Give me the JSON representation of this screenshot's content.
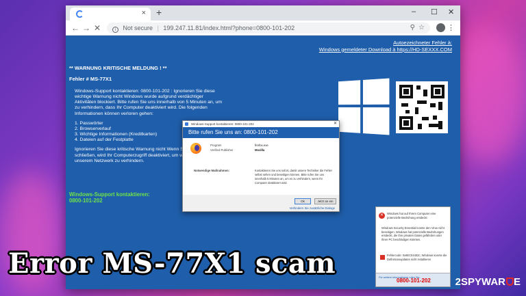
{
  "browser": {
    "tab_close": "×",
    "new_tab": "+",
    "window_controls": [
      "–",
      "☐",
      "✕"
    ],
    "nav": [
      "←",
      "→",
      "✕"
    ],
    "security_label": "Not secure",
    "url": "199.247.11.81/index.html?phone=0800-101-202"
  },
  "scam_page": {
    "top_link_line1": "Autoezeichneter Fehler à:",
    "top_link_line2": "Windows gemeldeter  Download à https://HD-SEXXX.COM",
    "warning": "** WARNUNG KRITISCHE MELDUNG ! **",
    "error_code": "Fehler # MS-77X1",
    "paragraph1": "Windows-Support kontaktieren: 0800-101-202 : Ignorieren Sie diese wichtige Warnung nicht Windows wurde aufgrund verdächtiger Aktivitäten blockiert. Bitte rufen Sie uns innerhalb von 5 Minuten an, um zu verhindern, dass Ihr Computer deaktiviert wird. Die folgenden Informationen können verloren gehen:",
    "list": [
      "1. Passwörter",
      "2. Browserverlauf",
      "3. Wichtige Informationen (Kreditkarten)",
      "4. Dateien auf der Festplatte"
    ],
    "paragraph2": "Ignorieren Sie diese kritische Warnung nicht Wenn Sie diese Seite schließen, wird Ihr Computerzugriff deaktiviert, um weitere Schäden an unserem Netzwerk zu verhindern.",
    "contact_line1": "Windows-Support kontaktieren:",
    "contact_line2": "0800-101-202"
  },
  "dialog": {
    "window_title": "Windows-Support kontaktieren: 0800-101-202",
    "close": "✕",
    "header": "Bitte rufen Sie uns an: 0800-101-202",
    "program_label": "Program",
    "verified_label": "Verified Publisher",
    "program_value": "firefox.exe",
    "verified_value": "Mozilla",
    "action_label": "Notwendige Maßnahmen:",
    "message": "Kontaktieren Sie uns sofort, damit unsere Techniker die Fehler selbst sehen und beseitigen können. Bitte rufen Sie uns innerhalb 5 Minuten an, um es zu verhindern, wenn Ihr Computer deaktiviert wird.",
    "ok_label": "Ok",
    "cancel_label": "Jetzt an ein",
    "link": "Verhindern Sie zusätzliche Dialoge"
  },
  "notification": {
    "title": "Windows hat auf Ihrem Computer eine potenzielle Bedrohung entdeckt",
    "body": "Windows Security Essential konnte den Virus nicht beseitigen. Windows hat potenzielle Bedrohungen entdeckt, die Ihre privaten Daten gefährden oder Ihren PC beschädigen könnten.",
    "error_code": "Fehlercode: 0x8EC04402c; Windows konnte die Definitionsupdates nicht installieren",
    "footer_label": "Für weitere Informationen rufen Sie:",
    "phone": "0800-101-202"
  },
  "overlay": {
    "caption": "Error MS-77X1 scam",
    "brand_digit": "2",
    "brand_name": "SPYWAR",
    "brand_end": "E"
  },
  "colors": {
    "page_blue": "#1f5eaa",
    "dialog_header": "#1f5fb0",
    "green_text": "#6fe34a",
    "alert_red": "#d93025"
  }
}
